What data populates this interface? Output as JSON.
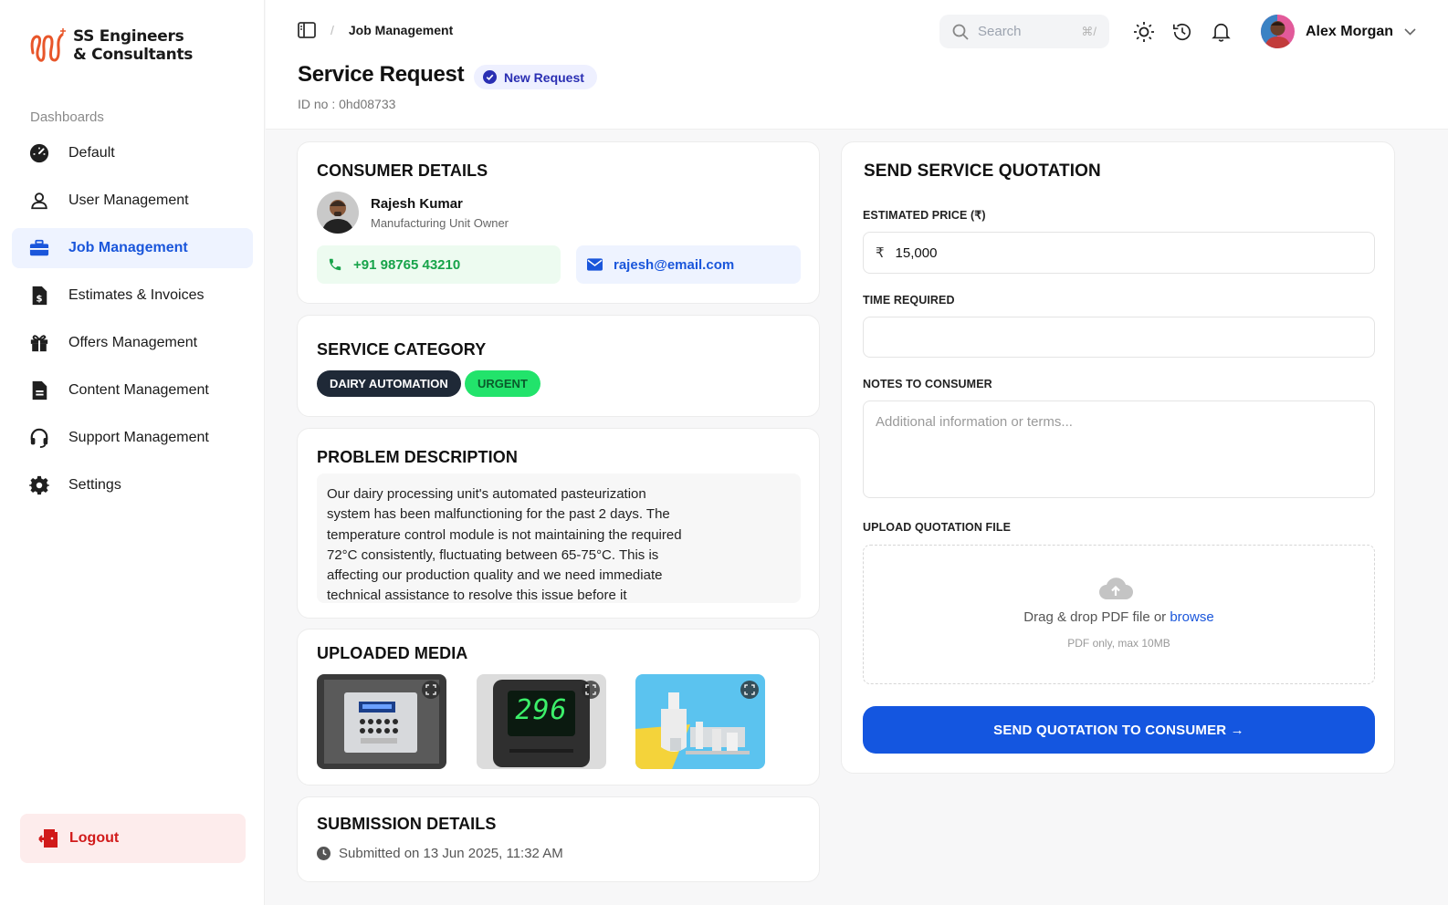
{
  "brand": {
    "line1": "SS Engineers",
    "line2": "& Consultants"
  },
  "sidebar": {
    "section": "Dashboards",
    "items": [
      {
        "label": "Default",
        "icon": "dashboard-gauge-icon"
      },
      {
        "label": "User Management",
        "icon": "user-icon"
      },
      {
        "label": "Job Management",
        "icon": "briefcase-icon",
        "active": true
      },
      {
        "label": "Estimates & Invoices",
        "icon": "invoice-icon"
      },
      {
        "label": "Offers Management",
        "icon": "gift-icon"
      },
      {
        "label": "Content Management",
        "icon": "document-icon"
      },
      {
        "label": "Support Management",
        "icon": "headset-icon"
      },
      {
        "label": "Settings",
        "icon": "gear-icon"
      }
    ],
    "logout": "Logout"
  },
  "header": {
    "breadcrumb": "Job Management",
    "title": "Service Request",
    "badge": "New Request",
    "id_label": "ID no : 0hd08733",
    "search_placeholder": "Search",
    "search_shortcut": "⌘/",
    "user_name": "Alex Morgan"
  },
  "consumer": {
    "heading": "CONSUMER DETAILS",
    "name": "Rajesh Kumar",
    "role": "Manufacturing Unit Owner",
    "phone": "+91 98765 43210",
    "email": "rajesh@email.com"
  },
  "category": {
    "heading": "SERVICE CATEGORY",
    "tags": [
      "DAIRY AUTOMATION",
      "URGENT"
    ]
  },
  "problem": {
    "heading": "PROBLEM DESCRIPTION",
    "text": "Our dairy processing unit's automated pasteurization system has been malfunctioning for the past 2 days. The temperature control module is not maintaining the required 72°C consistently, fluctuating between 65-75°C. This is affecting our production quality and we need immediate technical assistance to resolve this issue before it"
  },
  "media": {
    "heading": "UPLOADED MEDIA",
    "display_reading": "296"
  },
  "submission": {
    "heading": "SUBMISSION DETAILS",
    "text": "Submitted on 13 Jun 2025, 11:32 AM"
  },
  "quotation": {
    "heading": "SEND SERVICE QUOTATION",
    "price_label": "ESTIMATED PRICE (₹)",
    "currency": "₹",
    "price_value": "15,000",
    "time_label": "TIME REQUIRED",
    "time_value": "",
    "notes_label": "NOTES TO CONSUMER",
    "notes_placeholder": "Additional information or terms...",
    "upload_label": "UPLOAD QUOTATION FILE",
    "drop_text": "Drag & drop PDF file or ",
    "browse": "browse",
    "drop_sub": "PDF only, max 10MB",
    "send_button": "SEND QUOTATION TO CONSUMER →"
  },
  "colors": {
    "accent": "#1456e0",
    "active_nav_bg": "#eef3ff",
    "urgent": "#22e36b",
    "logout": "#d11a1a"
  }
}
